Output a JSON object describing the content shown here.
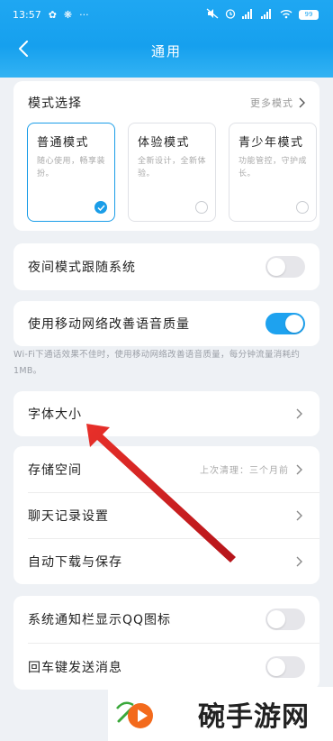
{
  "status_bar": {
    "time": "13:57",
    "battery": "99"
  },
  "header": {
    "title": "通用"
  },
  "mode_section": {
    "title": "模式选择",
    "more_label": "更多模式",
    "modes": [
      {
        "title": "普通模式",
        "desc": "随心使用，畅享装扮。",
        "selected": true
      },
      {
        "title": "体验模式",
        "desc": "全新设计，全新体验。",
        "selected": false
      },
      {
        "title": "青少年模式",
        "desc": "功能管控，守护成长。",
        "selected": false
      }
    ]
  },
  "night_mode": {
    "label": "夜间模式跟随系统",
    "on": false
  },
  "mobile_voice": {
    "label": "使用移动网络改善语音质量",
    "on": true,
    "note": "Wi-Fi下通话效果不佳时，使用移动网络改善语音质量，每分钟流量消耗约1MB。"
  },
  "font_size": {
    "label": "字体大小"
  },
  "storage_section": {
    "storage_label": "存储空间",
    "storage_hint": "上次清理：三个月前",
    "chat_label": "聊天记录设置",
    "download_label": "自动下载与保存"
  },
  "notify_section": {
    "qq_icon_label": "系统通知栏显示QQ图标",
    "qq_icon_on": false,
    "enter_send_label": "回车键发送消息",
    "enter_send_on": false
  },
  "watermark": {
    "text": "碗手游网"
  },
  "colors": {
    "header": "#1fa7f2",
    "accent": "#1ea2ef",
    "annotation_arrow": "#d9211f"
  }
}
